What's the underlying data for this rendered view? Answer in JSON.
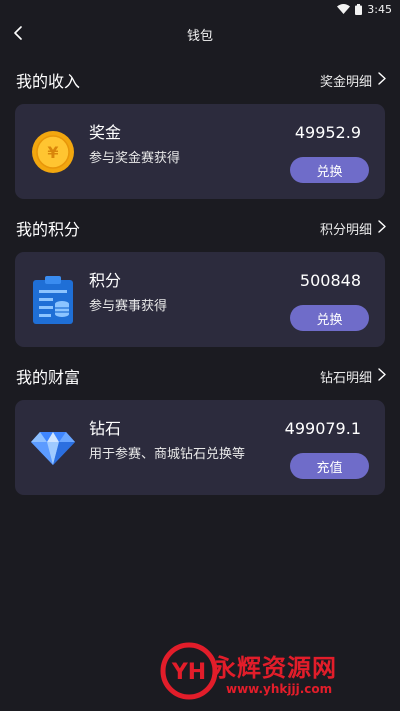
{
  "status_bar": {
    "time": "3:45"
  },
  "nav": {
    "title": "钱包"
  },
  "sections": [
    {
      "title": "我的收入",
      "detail_link": "奖金明细",
      "card": {
        "name": "奖金",
        "description": "参与奖金赛获得",
        "value": "49952.9",
        "button": "兑换",
        "icon": "gold-coin-icon"
      }
    },
    {
      "title": "我的积分",
      "detail_link": "积分明细",
      "card": {
        "name": "积分",
        "description": "参与赛事获得",
        "value": "500848",
        "button": "兑换",
        "icon": "points-clipboard-icon"
      }
    },
    {
      "title": "我的财富",
      "detail_link": "钻石明细",
      "card": {
        "name": "钻石",
        "description": "用于参赛、商城钻石兑换等",
        "value": "499079.1",
        "button": "充值",
        "icon": "diamond-icon"
      }
    }
  ],
  "watermark": {
    "text": "永辉资源网",
    "url": "www.yhkjjj.com",
    "logo_text": "YH"
  },
  "colors": {
    "background": "#1b1b21",
    "card": "#2c2b3d",
    "button": "#6f6cc9",
    "watermark": "#e21d2a"
  }
}
